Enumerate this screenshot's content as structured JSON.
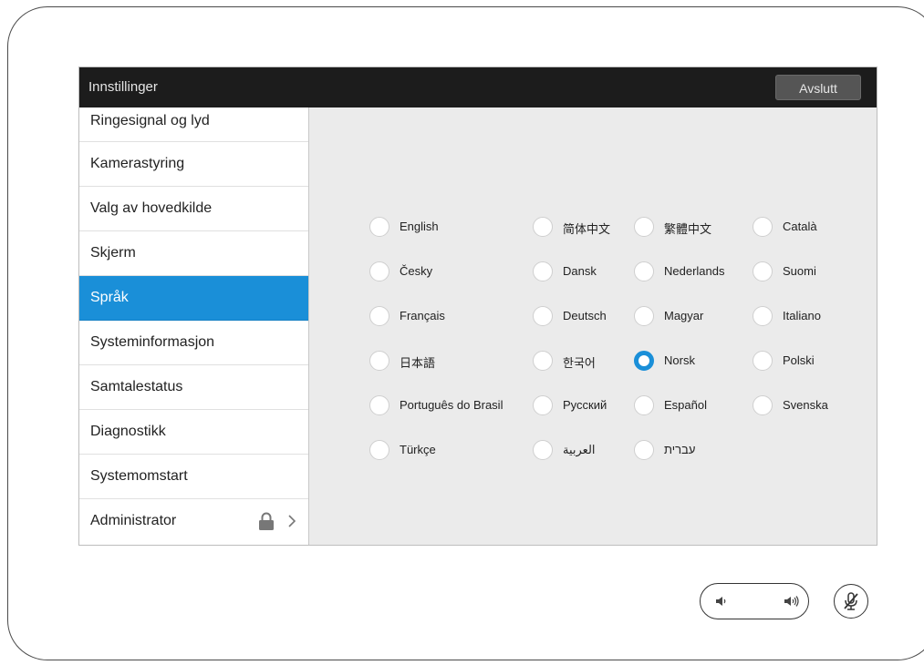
{
  "window": {
    "title": "Innstillinger",
    "exit_label": "Avslutt"
  },
  "sidebar": {
    "items": [
      {
        "label": "Ringesignal og lyd"
      },
      {
        "label": "Kamerastyring"
      },
      {
        "label": "Valg av hovedkilde"
      },
      {
        "label": "Skjerm"
      },
      {
        "label": "Språk",
        "active": true
      },
      {
        "label": "Systeminformasjon"
      },
      {
        "label": "Samtalestatus"
      },
      {
        "label": "Diagnostikk"
      },
      {
        "label": "Systemomstart"
      },
      {
        "label": "Administrator",
        "icons": [
          "lock-icon",
          "chevron-right-icon"
        ]
      }
    ]
  },
  "languages": {
    "selected": "Norsk",
    "options": [
      "English",
      "简体中文",
      "繁體中文",
      "Català",
      "Česky",
      "Dansk",
      "Nederlands",
      "Suomi",
      "Français",
      "Deutsch",
      "Magyar",
      "Italiano",
      "日本語",
      "한국어",
      "Norsk",
      "Polski",
      "Português do Brasil",
      "Русский",
      "Español",
      "Svenska",
      "Türkçe",
      "العربية",
      "עברית"
    ]
  },
  "controls": {
    "volume_icons": [
      "volume-down-icon",
      "volume-up-icon"
    ],
    "mute_icon": "microphone-muted-icon"
  },
  "colors": {
    "accent": "#1a8fd8",
    "titlebar": "#1c1c1c",
    "content_bg": "#ebebeb"
  }
}
